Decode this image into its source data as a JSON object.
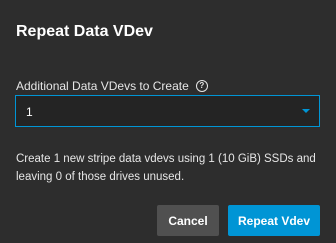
{
  "dialog": {
    "title": "Repeat Data VDev",
    "field": {
      "label": "Additional Data VDevs to Create",
      "help_icon": "help-circle-icon",
      "value": "1"
    },
    "description": "Create 1 new stripe data vdevs using 1 (10 GiB) SSDs and leaving 0 of those drives unused.",
    "buttons": {
      "cancel_label": "Cancel",
      "confirm_label": "Repeat Vdev"
    }
  },
  "colors": {
    "background": "#2d2d2d",
    "accent": "#0095d5",
    "secondary_button": "#505050",
    "text": "#ffffff"
  }
}
